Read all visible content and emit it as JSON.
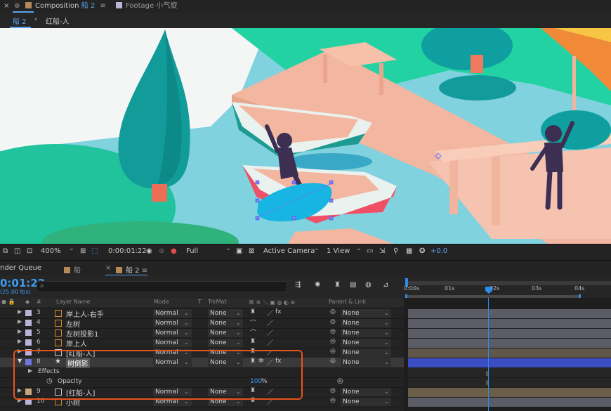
{
  "tabs": {
    "composition_label": "Composition",
    "composition_name": "船 2",
    "footage_label": "Footage",
    "footage_name": "小气旋"
  },
  "breadcrumb": [
    "船 2",
    "红船-人"
  ],
  "viewer_toolbar": {
    "zoom": "400%",
    "timecode": "0:00:01:22",
    "resolution": "Full",
    "camera": "Active Camera",
    "view": "1 View",
    "exposure": "+0.0"
  },
  "timeline_tabs": [
    "nder Queue",
    "船",
    "船 2"
  ],
  "timeline": {
    "current_time": "0:01:22",
    "fps": "(25.00 fps)",
    "search_placeholder": "",
    "ruler_ticks": [
      "0:00s",
      "01s",
      "02s",
      "03s",
      "04s"
    ]
  },
  "columns": {
    "number": "#",
    "layer_name": "Layer Name",
    "mode": "Mode",
    "t": "T",
    "trkmat": "TrkMat",
    "parent_link": "Parent & Link"
  },
  "layers": [
    {
      "num": "3",
      "name": "岸上人-右手",
      "mode": "Normal",
      "trkmat": "None",
      "parent": "None",
      "color": "#b9b3d9"
    },
    {
      "num": "4",
      "name": "左树",
      "mode": "Normal",
      "trkmat": "None",
      "parent": "None",
      "color": "#b9b3d9"
    },
    {
      "num": "5",
      "name": "左树投影1",
      "mode": "Normal",
      "trkmat": "None",
      "parent": "None",
      "color": "#b9b3d9"
    },
    {
      "num": "6",
      "name": "岸上人",
      "mode": "Normal",
      "trkmat": "None",
      "parent": "None",
      "color": "#b9b3d9"
    },
    {
      "num": "7",
      "name": "[红船-人]",
      "mode": "Normal",
      "trkmat": "None",
      "parent": "None",
      "color": "#b9b3d9"
    },
    {
      "num": "8",
      "name": "树倒影",
      "mode": "Normal",
      "trkmat": "None",
      "parent": "None",
      "color": "#6a78e0"
    },
    {
      "num": "9",
      "name": "[红船-人]",
      "mode": "Normal",
      "trkmat": "None",
      "parent": "None",
      "color": "#c5a77a"
    },
    {
      "num": "10",
      "name": "小树",
      "mode": "Normal",
      "trkmat": "None",
      "parent": "None",
      "color": "#b9b3d9"
    }
  ],
  "effects_label": "Effects",
  "opacity": {
    "label": "Opacity",
    "value": "100",
    "unit": "%"
  },
  "colors": {
    "accent": "#2d8ceb",
    "highlight_box": "#e8531d",
    "selected_track": "#3c4ec4"
  }
}
